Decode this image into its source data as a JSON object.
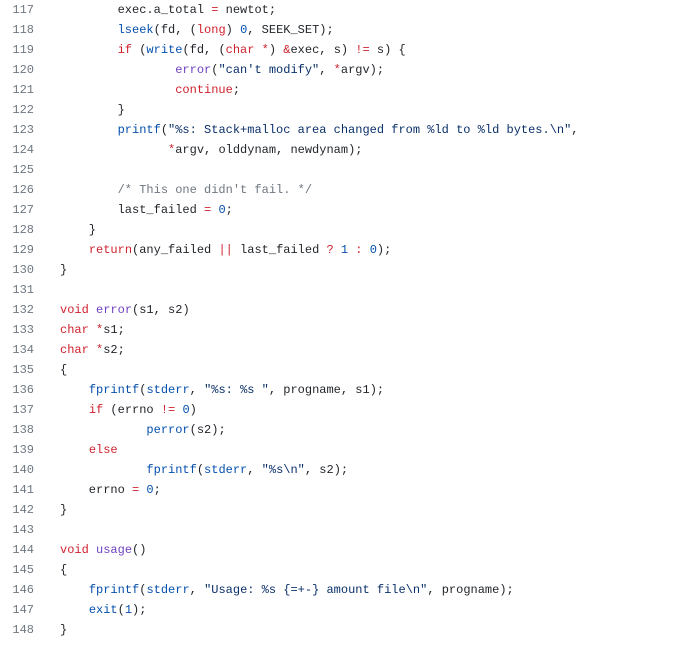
{
  "lines": [
    {
      "num": "117",
      "tokens": [
        [
          "        exec.",
          ""
        ],
        [
          "a_total",
          "pl-smi"
        ],
        [
          " ",
          ""
        ],
        [
          "=",
          "pl-k"
        ],
        [
          " newtot;",
          ""
        ]
      ]
    },
    {
      "num": "118",
      "tokens": [
        [
          "        ",
          ""
        ],
        [
          "lseek",
          "pl-c1"
        ],
        [
          "(fd, (",
          ""
        ],
        [
          "long",
          "pl-k"
        ],
        [
          ") ",
          ""
        ],
        [
          "0",
          "pl-c1"
        ],
        [
          ", SEEK_SET);",
          ""
        ]
      ]
    },
    {
      "num": "119",
      "tokens": [
        [
          "        ",
          ""
        ],
        [
          "if",
          "pl-k"
        ],
        [
          " (",
          ""
        ],
        [
          "write",
          "pl-c1"
        ],
        [
          "(fd, (",
          ""
        ],
        [
          "char",
          "pl-k"
        ],
        [
          " ",
          ""
        ],
        [
          "*",
          "pl-k"
        ],
        [
          ") ",
          ""
        ],
        [
          "&",
          "pl-k"
        ],
        [
          "exec, s) ",
          ""
        ],
        [
          "!=",
          "pl-k"
        ],
        [
          " s) {",
          ""
        ]
      ]
    },
    {
      "num": "120",
      "tokens": [
        [
          "                ",
          ""
        ],
        [
          "error",
          "pl-en"
        ],
        [
          "(",
          ""
        ],
        [
          "\"can't modify\"",
          "pl-s"
        ],
        [
          ", ",
          ""
        ],
        [
          "*",
          "pl-k"
        ],
        [
          "argv);",
          ""
        ]
      ]
    },
    {
      "num": "121",
      "tokens": [
        [
          "                ",
          ""
        ],
        [
          "continue",
          "pl-k"
        ],
        [
          ";",
          ""
        ]
      ]
    },
    {
      "num": "122",
      "tokens": [
        [
          "        }",
          ""
        ]
      ]
    },
    {
      "num": "123",
      "tokens": [
        [
          "        ",
          ""
        ],
        [
          "printf",
          "pl-c1"
        ],
        [
          "(",
          ""
        ],
        [
          "\"%s: Stack+malloc area changed from %ld to %ld bytes.\\n\"",
          "pl-s"
        ],
        [
          ",",
          ""
        ]
      ]
    },
    {
      "num": "124",
      "tokens": [
        [
          "               ",
          ""
        ],
        [
          "*",
          "pl-k"
        ],
        [
          "argv, olddynam, newdynam);",
          ""
        ]
      ]
    },
    {
      "num": "125",
      "tokens": [
        [
          "",
          ""
        ]
      ]
    },
    {
      "num": "126",
      "tokens": [
        [
          "        ",
          ""
        ],
        [
          "/* This one didn't fail. */",
          "pl-c"
        ]
      ]
    },
    {
      "num": "127",
      "tokens": [
        [
          "        last_failed ",
          ""
        ],
        [
          "=",
          "pl-k"
        ],
        [
          " ",
          ""
        ],
        [
          "0",
          "pl-c1"
        ],
        [
          ";",
          ""
        ]
      ]
    },
    {
      "num": "128",
      "tokens": [
        [
          "    }",
          ""
        ]
      ]
    },
    {
      "num": "129",
      "tokens": [
        [
          "    ",
          ""
        ],
        [
          "return",
          "pl-k"
        ],
        [
          "(any_failed ",
          ""
        ],
        [
          "||",
          "pl-k"
        ],
        [
          " last_failed ",
          ""
        ],
        [
          "?",
          "pl-k"
        ],
        [
          " ",
          ""
        ],
        [
          "1",
          "pl-c1"
        ],
        [
          " ",
          ""
        ],
        [
          ":",
          "pl-k"
        ],
        [
          " ",
          ""
        ],
        [
          "0",
          "pl-c1"
        ],
        [
          ");",
          ""
        ]
      ]
    },
    {
      "num": "130",
      "tokens": [
        [
          "}",
          ""
        ]
      ]
    },
    {
      "num": "131",
      "tokens": [
        [
          "",
          ""
        ]
      ]
    },
    {
      "num": "132",
      "tokens": [
        [
          "",
          ""
        ],
        [
          "void",
          "pl-k"
        ],
        [
          " ",
          ""
        ],
        [
          "error",
          "pl-en"
        ],
        [
          "(s1, s2)",
          ""
        ]
      ]
    },
    {
      "num": "133",
      "tokens": [
        [
          "",
          ""
        ],
        [
          "char",
          "pl-k"
        ],
        [
          " ",
          ""
        ],
        [
          "*",
          "pl-k"
        ],
        [
          "s1;",
          ""
        ]
      ]
    },
    {
      "num": "134",
      "tokens": [
        [
          "",
          ""
        ],
        [
          "char",
          "pl-k"
        ],
        [
          " ",
          ""
        ],
        [
          "*",
          "pl-k"
        ],
        [
          "s2;",
          ""
        ]
      ]
    },
    {
      "num": "135",
      "tokens": [
        [
          "{",
          ""
        ]
      ]
    },
    {
      "num": "136",
      "tokens": [
        [
          "    ",
          ""
        ],
        [
          "fprintf",
          "pl-c1"
        ],
        [
          "(",
          ""
        ],
        [
          "stderr",
          "pl-c1"
        ],
        [
          ", ",
          ""
        ],
        [
          "\"%s: %s \"",
          "pl-s"
        ],
        [
          ", progname, s1);",
          ""
        ]
      ]
    },
    {
      "num": "137",
      "tokens": [
        [
          "    ",
          ""
        ],
        [
          "if",
          "pl-k"
        ],
        [
          " (errno ",
          ""
        ],
        [
          "!=",
          "pl-k"
        ],
        [
          " ",
          ""
        ],
        [
          "0",
          "pl-c1"
        ],
        [
          ")",
          ""
        ]
      ]
    },
    {
      "num": "138",
      "tokens": [
        [
          "            ",
          ""
        ],
        [
          "perror",
          "pl-c1"
        ],
        [
          "(s2);",
          ""
        ]
      ]
    },
    {
      "num": "139",
      "tokens": [
        [
          "    ",
          ""
        ],
        [
          "else",
          "pl-k"
        ]
      ]
    },
    {
      "num": "140",
      "tokens": [
        [
          "            ",
          ""
        ],
        [
          "fprintf",
          "pl-c1"
        ],
        [
          "(",
          ""
        ],
        [
          "stderr",
          "pl-c1"
        ],
        [
          ", ",
          ""
        ],
        [
          "\"%s\\n\"",
          "pl-s"
        ],
        [
          ", s2);",
          ""
        ]
      ]
    },
    {
      "num": "141",
      "tokens": [
        [
          "    errno ",
          ""
        ],
        [
          "=",
          "pl-k"
        ],
        [
          " ",
          ""
        ],
        [
          "0",
          "pl-c1"
        ],
        [
          ";",
          ""
        ]
      ]
    },
    {
      "num": "142",
      "tokens": [
        [
          "}",
          ""
        ]
      ]
    },
    {
      "num": "143",
      "tokens": [
        [
          "",
          ""
        ]
      ]
    },
    {
      "num": "144",
      "tokens": [
        [
          "",
          ""
        ],
        [
          "void",
          "pl-k"
        ],
        [
          " ",
          ""
        ],
        [
          "usage",
          "pl-en"
        ],
        [
          "()",
          ""
        ]
      ]
    },
    {
      "num": "145",
      "tokens": [
        [
          "{",
          ""
        ]
      ]
    },
    {
      "num": "146",
      "tokens": [
        [
          "    ",
          ""
        ],
        [
          "fprintf",
          "pl-c1"
        ],
        [
          "(",
          ""
        ],
        [
          "stderr",
          "pl-c1"
        ],
        [
          ", ",
          ""
        ],
        [
          "\"Usage: %s {=+-} amount file\\n\"",
          "pl-s"
        ],
        [
          ", progname);",
          ""
        ]
      ]
    },
    {
      "num": "147",
      "tokens": [
        [
          "    ",
          ""
        ],
        [
          "exit",
          "pl-c1"
        ],
        [
          "(",
          ""
        ],
        [
          "1",
          "pl-c1"
        ],
        [
          ");",
          ""
        ]
      ]
    },
    {
      "num": "148",
      "tokens": [
        [
          "}",
          ""
        ]
      ]
    }
  ]
}
